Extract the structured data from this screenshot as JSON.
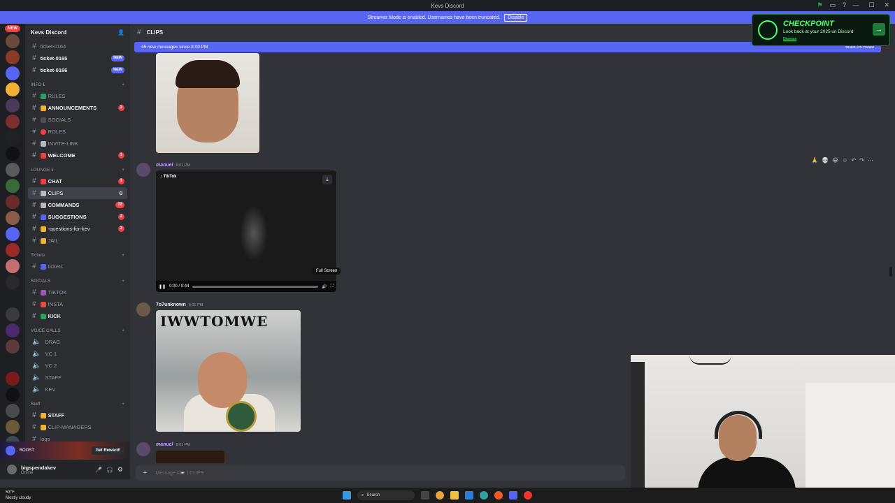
{
  "titlebar": {
    "title": "Kevs Discord"
  },
  "banner": {
    "text": "Streamer Mode is enabled. Usernames have been truncated.",
    "action": "Disable"
  },
  "guilds": {
    "new_label": "NEW"
  },
  "server": {
    "name": "Kevs Discord"
  },
  "channels": {
    "top": [
      {
        "name": "ticket-0164",
        "badge": ""
      },
      {
        "name": "ticket-0165",
        "badge": "NEW"
      },
      {
        "name": "ticket-0166",
        "badge": "NEW"
      }
    ],
    "info_label": "INFO ℹ",
    "info": [
      {
        "name": "RULES",
        "badge": "",
        "color": "#23a55a"
      },
      {
        "name": "ANNOUNCEMENTS",
        "badge": "2",
        "color": "#f0b232"
      },
      {
        "name": "SOCIALS",
        "badge": "",
        "color": "#949ba4"
      },
      {
        "name": "ROLES",
        "badge": "",
        "color": "#f23f42"
      },
      {
        "name": "INVITE-LINK",
        "badge": "",
        "color": "#b5bac1"
      },
      {
        "name": "WELCOME",
        "badge": "1",
        "color": "#f23f42"
      }
    ],
    "lounge_label": "LOUNGE ℹ",
    "lounge": [
      {
        "name": "CHAT",
        "badge": "1",
        "color": "#f23f42"
      },
      {
        "name": "CLIPS",
        "badge": "",
        "color": "#b5bac1"
      },
      {
        "name": "COMMANDS",
        "badge": "22",
        "color": "#b5bac1"
      },
      {
        "name": "SUGGESTIONS",
        "badge": "2",
        "color": "#5865f2"
      },
      {
        "name": "-questions-for-kev",
        "badge": "2",
        "color": "#f0b232"
      },
      {
        "name": "JAIL",
        "badge": "",
        "color": "#f0b232"
      }
    ],
    "tickets_label": "Tickets",
    "tickets": [
      {
        "name": "tickets"
      }
    ],
    "socials_label": "SOCIALS",
    "socials": [
      {
        "name": "TIKTOK",
        "color": "#9b59b6"
      },
      {
        "name": "INSTA",
        "color": "#e74c3c"
      },
      {
        "name": "KICK",
        "color": "#23a55a"
      }
    ],
    "voice_label": "VOICE CALLS",
    "voice": [
      {
        "name": "DRAG"
      },
      {
        "name": "VC 1"
      },
      {
        "name": "VC 2"
      },
      {
        "name": "STAFF"
      },
      {
        "name": "KEV"
      }
    ],
    "staff_label": "Staff",
    "staff": [
      {
        "name": "STAFF"
      },
      {
        "name": "CLIP-MANAGERS"
      },
      {
        "name": "logs"
      }
    ]
  },
  "boost": {
    "text": "BOOST",
    "reward": "Get Reward!"
  },
  "user": {
    "name": "bigspendakev",
    "status": "Online"
  },
  "chat": {
    "channel": "CLIPS",
    "new_messages": "45 new messages since 8:09 PM",
    "mark_read": "Mark As Read",
    "messages": [
      {
        "author": "manuel",
        "time": "8:01 PM"
      },
      {
        "author": "7o7unknown",
        "time": "8:01 PM"
      },
      {
        "author": "manuel",
        "time": "8:01 PM"
      }
    ],
    "video": {
      "brand": "TikTok",
      "time": "0:00 / 0:44",
      "progress": 0.0,
      "tooltip": "Full Screen"
    },
    "meme_caption": "IWWTOMWE",
    "composer_placeholder": "Message #📼 | CLIPS"
  },
  "checkpoint": {
    "title": "CHECKPOINT",
    "subtitle": "Look back at your 2025 on Discord",
    "dismiss": "Dismiss"
  },
  "taskbar": {
    "weather_temp": "53°F",
    "weather_desc": "Mostly cloudy",
    "search": "Search"
  }
}
